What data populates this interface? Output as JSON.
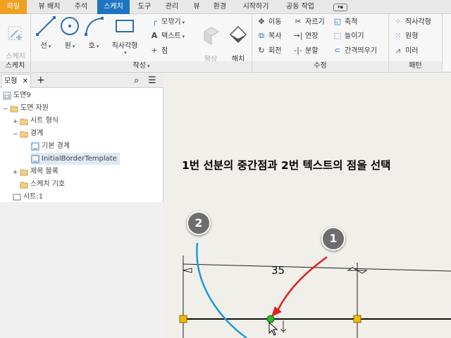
{
  "menu": {
    "tabs": [
      "파일",
      "뷰 배치",
      "주석",
      "스케치",
      "도구",
      "관리",
      "뷰",
      "환경",
      "시작하기",
      "공동 작업"
    ],
    "active": "스케치",
    "extra_icon": "dropdown-icon"
  },
  "ribbon": {
    "sketch_panel": {
      "title": "스케치",
      "start_sketch": "스케치\n시작"
    },
    "create_panel": {
      "title": "작성",
      "line": "선",
      "circle": "원",
      "arc": "호",
      "rectangle": "직사각형",
      "fillet": "모깎기",
      "text": "텍스트",
      "point": "점",
      "format": "형상\n투영",
      "hatch": "해치\n영역"
    },
    "modify_panel": {
      "title": "수정",
      "move": "이동",
      "copy": "복사",
      "rotate": "회전",
      "trim": "자르기",
      "extend": "연장",
      "split": "분할",
      "scale": "축척",
      "stretch": "늘이기",
      "offset": "간격띄우기"
    },
    "pattern_panel": {
      "title": "패턴",
      "rect_pattern": "직사각형",
      "circ_pattern": "원형",
      "mirror": "미러"
    }
  },
  "browser": {
    "tab_label": "모형",
    "tree": [
      {
        "label": "도면9",
        "indent": 0
      },
      {
        "label": "도면 자원",
        "indent": 1
      },
      {
        "label": "시트 형식",
        "indent": 2
      },
      {
        "label": "경계",
        "indent": 2
      },
      {
        "label": "기본 경계",
        "indent": 3
      },
      {
        "label": "InitialBorderTemplate",
        "indent": 3
      },
      {
        "label": "제목 블록",
        "indent": 2
      },
      {
        "label": "스케치 기호",
        "indent": 2
      },
      {
        "label": "시트:1",
        "indent": 1
      }
    ]
  },
  "canvas": {
    "instruction": "1번 선분의 중간점과 2번 텍스트의 점을 선택",
    "callout_1": "1",
    "callout_2": "2",
    "dimension": "35",
    "colors": {
      "line": "#111111",
      "arc": "#1a9ad6",
      "arrow": "#e02020",
      "endpoint": "#f5b800",
      "midpoint": "#2db82d"
    }
  }
}
